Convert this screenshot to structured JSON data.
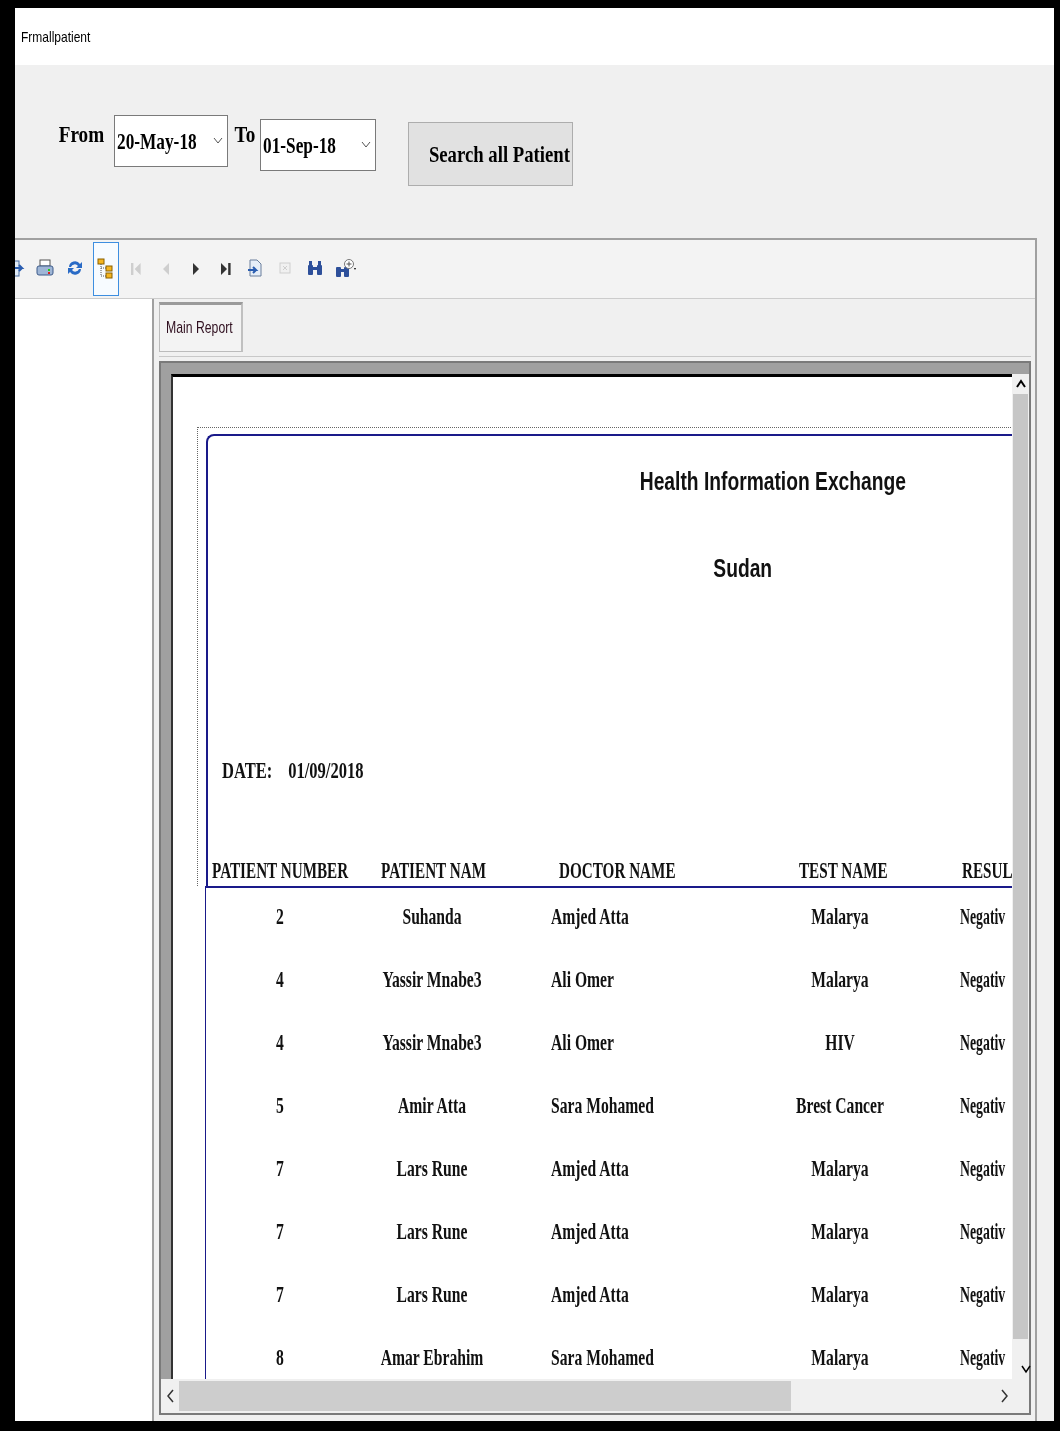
{
  "window": {
    "title": "Frmallpatient"
  },
  "filter": {
    "from_label": "From",
    "from_value": "20-May-18",
    "to_label": "To",
    "to_value": "01-Sep-18",
    "search_button": "Search all Patient"
  },
  "toolbar": [
    {
      "kind": "export",
      "selected": false,
      "disabled": false
    },
    {
      "kind": "print",
      "selected": false,
      "disabled": false
    },
    {
      "kind": "refresh",
      "selected": false,
      "disabled": false
    },
    {
      "kind": "group-tree",
      "selected": true,
      "disabled": false
    },
    {
      "kind": "first",
      "selected": false,
      "disabled": true
    },
    {
      "kind": "previous",
      "selected": false,
      "disabled": true
    },
    {
      "kind": "next",
      "selected": false,
      "disabled": false
    },
    {
      "kind": "last",
      "selected": false,
      "disabled": false
    },
    {
      "kind": "goto",
      "selected": false,
      "disabled": false
    },
    {
      "kind": "stop",
      "selected": false,
      "disabled": true
    },
    {
      "kind": "find",
      "selected": false,
      "disabled": false
    },
    {
      "kind": "zoom",
      "selected": false,
      "disabled": false
    }
  ],
  "tabs": [
    {
      "label": "Main Report",
      "selected": true
    }
  ],
  "report": {
    "title": "Health Information Exchange",
    "subtitle": "Sudan",
    "date_label": "DATE:",
    "date_value": "01/09/2018",
    "columns": [
      "PATIENT NUMBER",
      "PATIENT NAM",
      "DOCTOR NAME",
      "TEST NAME",
      "RESUL"
    ],
    "rows": [
      [
        "2",
        "Suhanda",
        "Amjed Atta",
        "Malarya",
        "Negativ"
      ],
      [
        "4",
        "Yassir Mnabe3",
        "Ali Omer",
        "Malarya",
        "Negativ"
      ],
      [
        "4",
        "Yassir Mnabe3",
        "Ali Omer",
        "HIV",
        "Negativ"
      ],
      [
        "5",
        "Amir Atta",
        "Sara Mohamed",
        "Brest Cancer",
        "Negativ"
      ],
      [
        "7",
        "Lars Rune",
        "Amjed Atta",
        "Malarya",
        "Negativ"
      ],
      [
        "7",
        "Lars Rune",
        "Amjed Atta",
        "Malarya",
        "Negativ"
      ],
      [
        "7",
        "Lars Rune",
        "Amjed Atta",
        "Malarya",
        "Negativ"
      ],
      [
        "8",
        "Amar Ebrahim",
        "Sara Mohamed",
        "Malarya",
        "Negativ"
      ]
    ]
  }
}
